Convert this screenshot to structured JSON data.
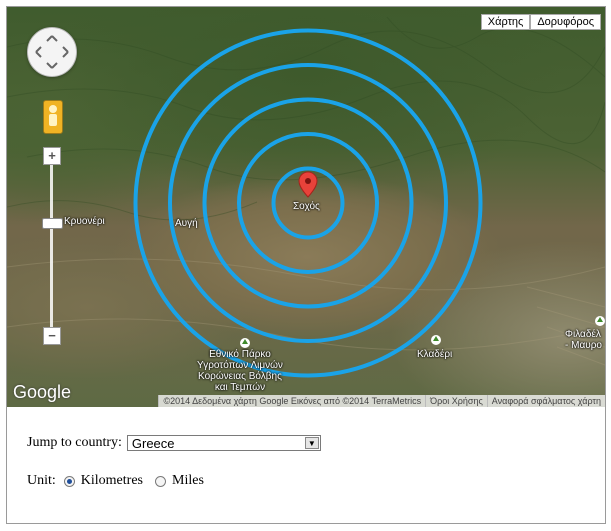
{
  "map": {
    "type_buttons": [
      "Χάρτης",
      "Δορυφόρος"
    ],
    "selected_type": "Δορυφόρος",
    "ring_color": "#1aa3e8",
    "ring_count": 5,
    "marker_label": "Σοχός",
    "places": {
      "place_1": "Κρυονέρι",
      "place_2": "Αυγή",
      "park": [
        "Εθνικό Πάρκο",
        "Υγροτόπων Λιμνών",
        "Κορώνειας Βόλβης",
        "και Τεμπών"
      ],
      "kladeri": "Κλαδέρι",
      "filadelfeia": [
        "Φιλαδέλ",
        "- Μαυρο"
      ]
    },
    "logo": "Google",
    "attribution": [
      "©2014 Δεδομένα χάρτη Google Εικόνες από ©2014 TerraMetrics",
      "Όροι Χρήσης",
      "Αναφορά σφάλματος χάρτη"
    ]
  },
  "controls": {
    "jump_label": "Jump to country:",
    "country_value": "Greece",
    "unit_label": "Unit:",
    "units": [
      {
        "label": "Kilometres",
        "selected": true
      },
      {
        "label": "Miles",
        "selected": false
      }
    ]
  }
}
